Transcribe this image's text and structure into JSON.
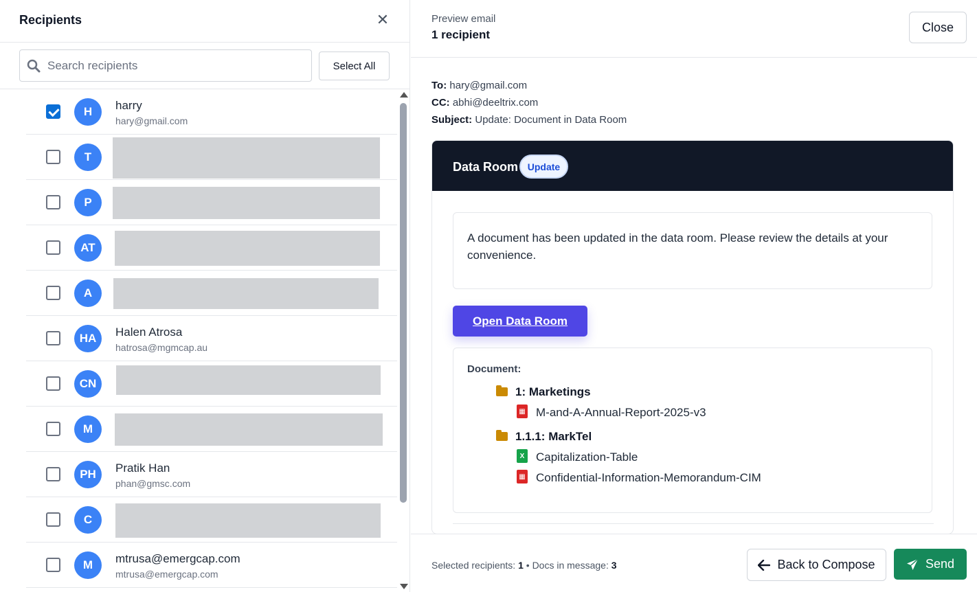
{
  "left": {
    "title": "Recipients",
    "search_placeholder": "Search recipients",
    "select_all_label": "Select All",
    "recipients": [
      {
        "initials": "H",
        "name": "harry",
        "email": "hary@gmail.com",
        "checked": true
      },
      {
        "initials": "T",
        "name": "",
        "email": "",
        "checked": false
      },
      {
        "initials": "P",
        "name": "",
        "email": "",
        "checked": false
      },
      {
        "initials": "AT",
        "name": "",
        "email": "",
        "checked": false
      },
      {
        "initials": "A",
        "name": "",
        "email": "",
        "checked": false
      },
      {
        "initials": "HA",
        "name": "Halen Atrosa",
        "email": "hatrosa@mgmcap.au",
        "checked": false
      },
      {
        "initials": "CN",
        "name": "",
        "email": "",
        "checked": false
      },
      {
        "initials": "M",
        "name": "",
        "email": "",
        "checked": false
      },
      {
        "initials": "PH",
        "name": "Pratik Han",
        "email": "phan@gmsc.com",
        "checked": false
      },
      {
        "initials": "C",
        "name": "",
        "email": "",
        "checked": false
      },
      {
        "initials": "M",
        "name": "mtrusa@emergcap.com",
        "email": "mtrusa@emergcap.com",
        "checked": false
      }
    ]
  },
  "right": {
    "header_sub": "Preview email",
    "header_title": "1 recipient",
    "close_label": "Close",
    "to_label": "To:",
    "to_value": "hary@gmail.com",
    "cc_label": "CC:",
    "cc_value": "abhi@deeltrix.com",
    "subject_label": "Subject:",
    "subject_value": "Update: Document in Data Room",
    "card_title": "Data Room",
    "badge": "Update",
    "message": "A document has been updated in the data room. Please review the details at your convenience.",
    "open_button": "Open Data Room",
    "docs_label": "Document:",
    "folder1": "1: Marketings",
    "doc1": "M-and-A-Annual-Report-2025-v3",
    "folder2": "1.1.1: MarkTel",
    "doc2": "Capitalization-Table",
    "doc3": "Confidential-Information-Memorandum-CIM",
    "footer_sel_label": "Selected recipients:",
    "footer_sel_count": "1",
    "footer_docs_label": "Docs in message:",
    "footer_docs_count": "3",
    "back_label": "Back to Compose",
    "send_label": "Send"
  },
  "colors": {
    "avatar": "#3b82f6",
    "checkbox_on": "#0b6fd6",
    "card_header": "#111827",
    "open_button": "#4f46e5",
    "send_button": "#16895a"
  }
}
